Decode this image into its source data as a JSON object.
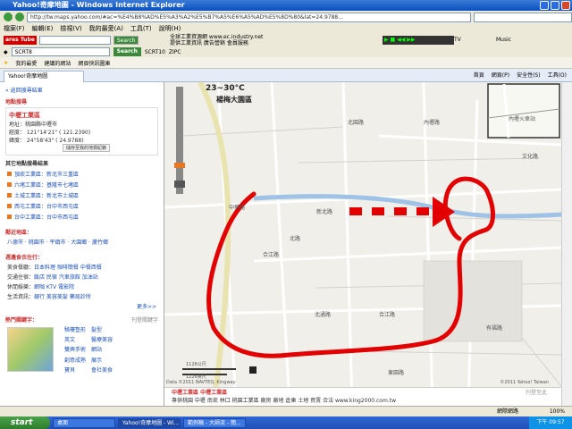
{
  "window": {
    "title": "Yahoo!奇摩地圖 - Windows Internet Explorer",
    "url": "http://tw.maps.yahoo.com/#ac=%E4%B8%AD%E5%A3%A2%E5%B7%A5%E6%A5%AD%E5%8D%80&lat=24.9788..."
  },
  "menu": [
    "檔案(F)",
    "編輯(E)",
    "檢視(V)",
    "我的最愛(A)",
    "工具(T)",
    "說明(H)"
  ],
  "toolbar1": {
    "badge": "ares Tube",
    "search_label": "Search",
    "ad_line1": "全球工業資源網 www.ec.industry.net",
    "ad_line2": "提供工業資訊 廣告營銷 會員服務",
    "tv": "TV",
    "music": "Music"
  },
  "toolbar2": {
    "field": "SCRT8",
    "search_btn": "Search",
    "code1": "SCRT10",
    "code2": "ZIPC"
  },
  "favorites": {
    "label": "我的最愛",
    "items": [
      "建議的網站",
      "網頁快訊圖庫"
    ]
  },
  "tab": {
    "label": "Yahoo!奇摩地圖",
    "tools": [
      "首頁",
      "網頁(P)",
      "安全性(S)",
      "工具(O)"
    ]
  },
  "sidebar": {
    "back_link": "« 返回搜尋結果",
    "section_title": "地點搜尋",
    "place_name": "中壢工業區",
    "address_label": "地址：桃園縣中壢市",
    "lon": "經度： 121°14'21\" ( 121.2390)",
    "lat": "緯度： 24°58'43\" ( 24.9788)",
    "save_btn": "儲存至我的地標紀錄",
    "related_title": "其它地點搜尋結果",
    "related": [
      "頂崁工業區：新北市三重區",
      "六堵工業區：基隆市七堵區",
      "土城工業區：新北市土城區",
      "西屯工業區：台中市西屯區",
      "台中工業區：台中市西屯區"
    ],
    "nearby_title": "鄰近地區：",
    "nearby": [
      "八德市",
      "桃園市",
      "平鎮市",
      "大園鄉",
      "蘆竹鄉"
    ],
    "life_title": "週邊食衣住行：",
    "life_rows": [
      {
        "label": "美食餐廳：",
        "items": "日本料理  咖啡簡餐  中餐西餐"
      },
      {
        "label": "交通住宿：",
        "items": "飯店  民宿  汽車旅館  加油站"
      },
      {
        "label": "休閒娛樂：",
        "items": "網咖  KTV  電影院"
      },
      {
        "label": "生活資訊：",
        "items": "銀行  美容美髮  藥局診所"
      }
    ],
    "more": "更多>>",
    "hot_title": "熱門關鍵字：",
    "hot_link": "刊登關鍵字",
    "hot_items": [
      "騎樓墊形",
      "英文",
      "雙興手術",
      "創意成熟",
      "寶貝",
      "髮型",
      "醫療美容",
      "網站",
      "展示",
      "會社美食"
    ]
  },
  "map": {
    "weather": "23~30°C",
    "place": "楊梅大園區",
    "scale_top": "1128公尺",
    "scale_bottom": "1226英尺",
    "copyright_left": "Data ©2011 NAVTEQ, Kingway",
    "copyright_right": "©2011 Yahoo! Taiwan",
    "ad_title": "中壢工業區 中壢工業區",
    "ad_text": "專供桃園 中壢 南崁 林口 桃園工業區 廠房 廠地 倉庫 土地 買賣 合法 www.king2000.com.tw",
    "ad_link": "刊登至此",
    "inset_label": "內壢火車站",
    "labels": [
      "中華路",
      "北路",
      "新北路",
      "北園路",
      "合江路",
      "有福路",
      "文化路",
      "內壢路",
      "合江路",
      "北通路",
      "東園路"
    ]
  },
  "status": {
    "zone": "網際網路",
    "zoom": "100%"
  },
  "taskbar": {
    "start": "start",
    "tasks": [
      "桌面",
      "Yahoo!奇摩地圖 - Wi...",
      "範例稿 - 大師流 - 簡..."
    ],
    "clock": "下午 09:57"
  }
}
